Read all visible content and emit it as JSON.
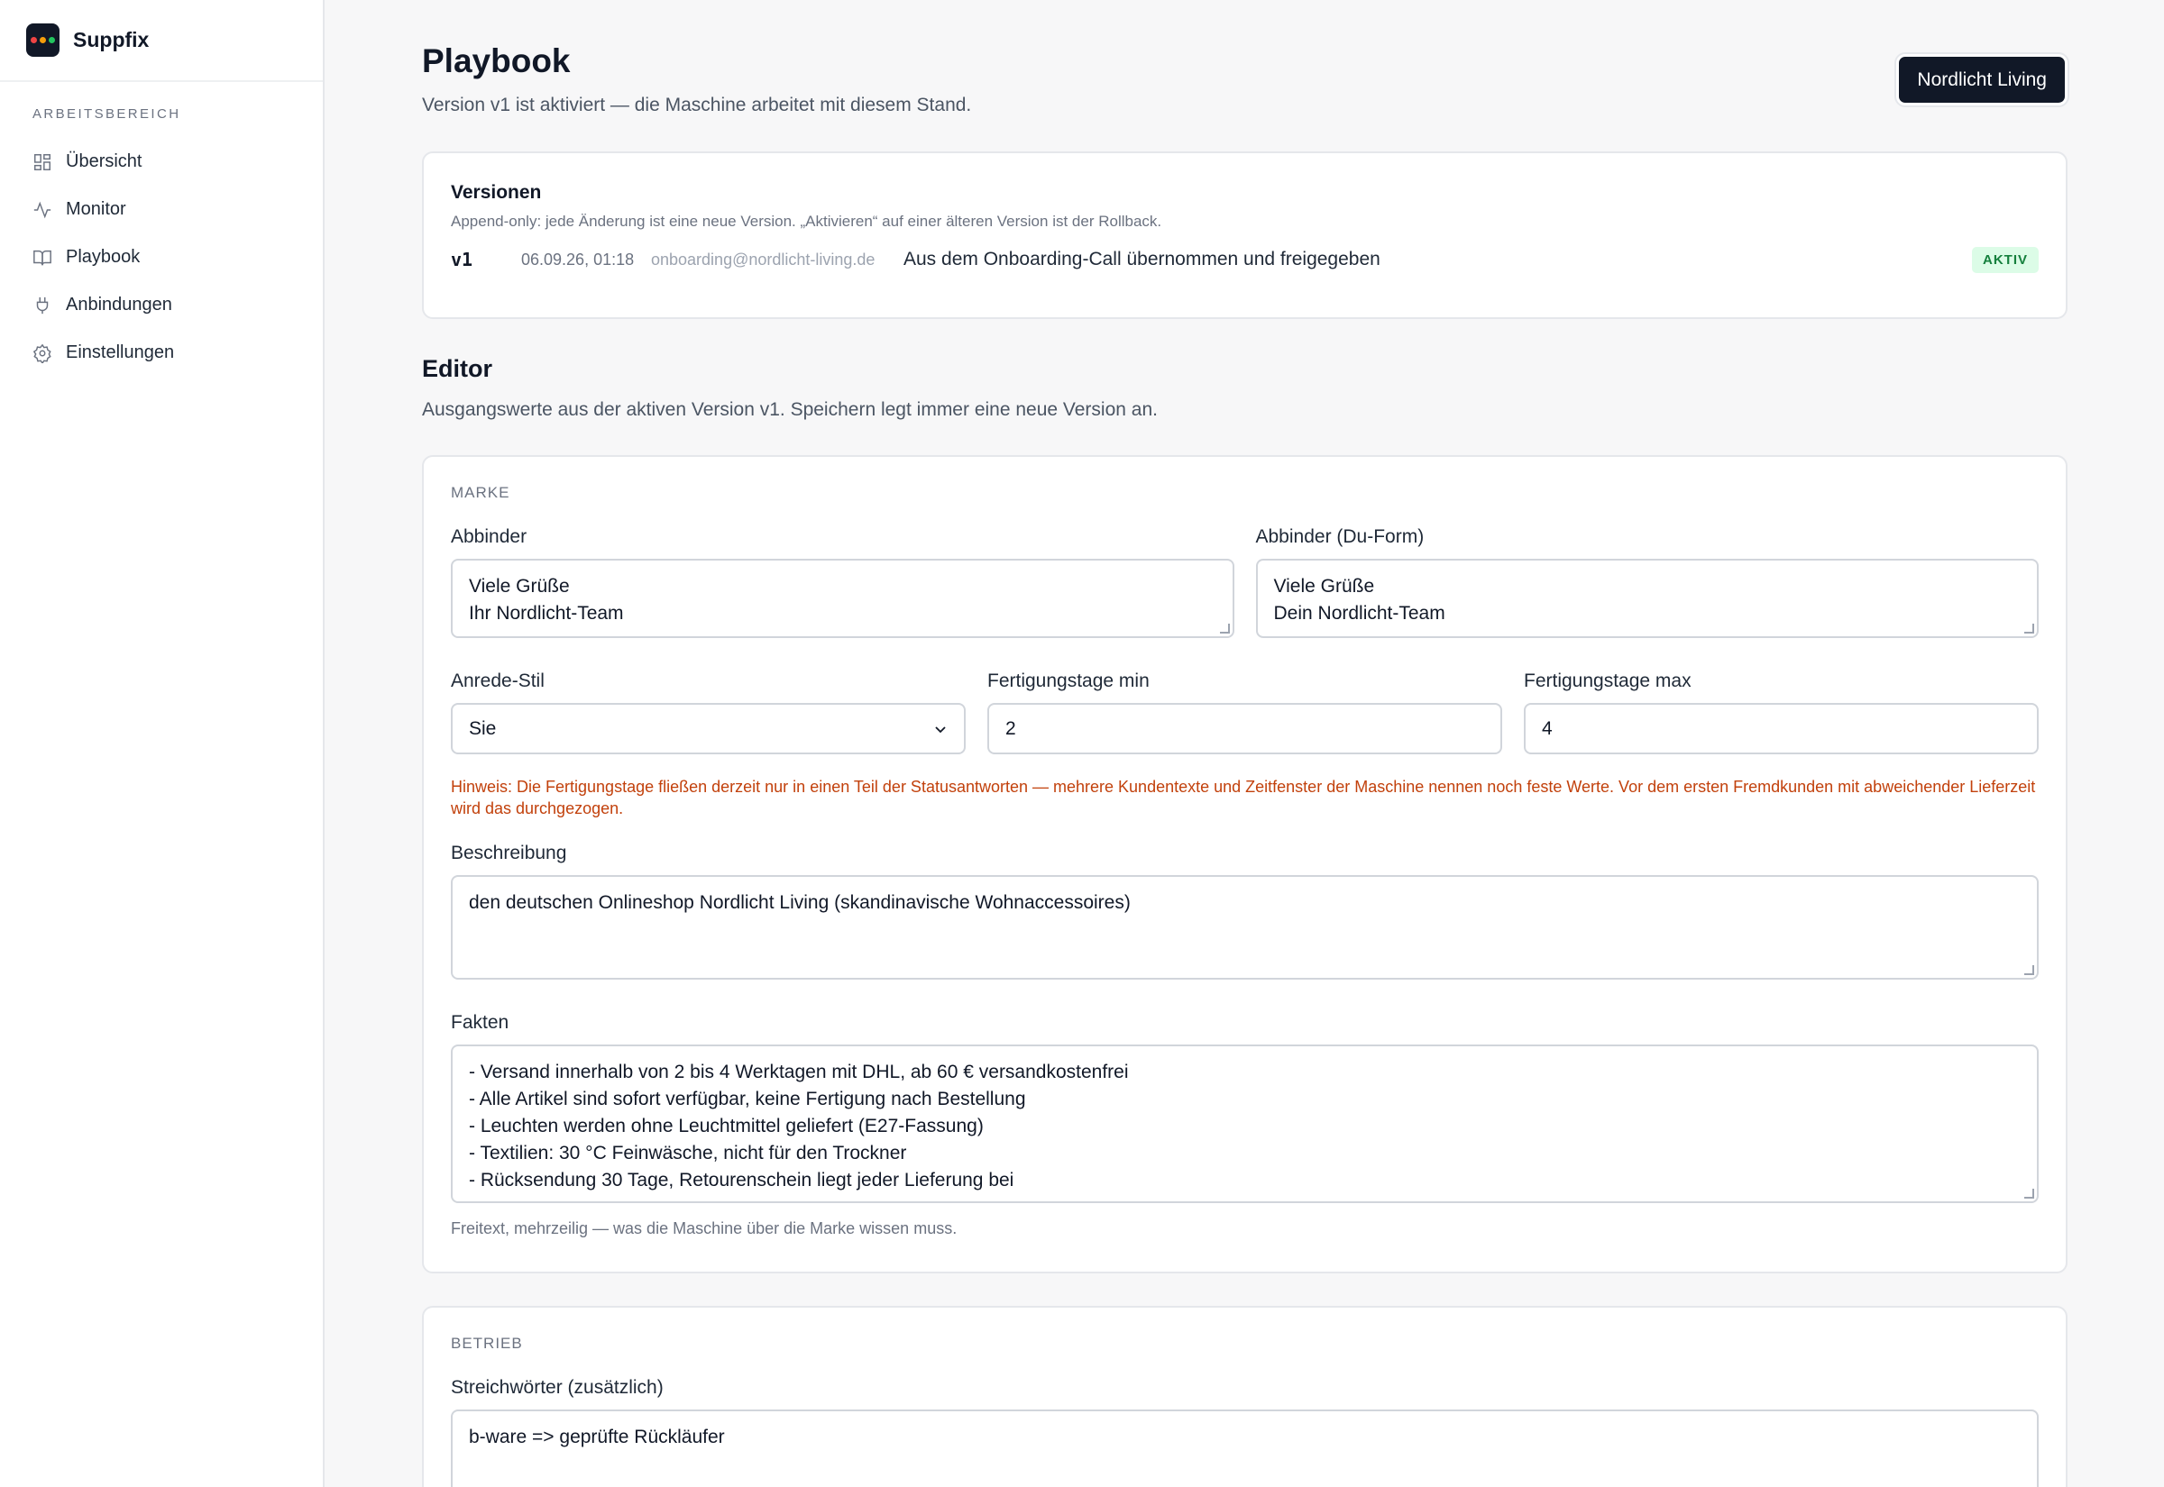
{
  "app": {
    "name": "Suppfix"
  },
  "sidebar": {
    "section_label": "ARBEITSBEREICH",
    "items": [
      {
        "label": "Übersicht",
        "icon": "grid-icon"
      },
      {
        "label": "Monitor",
        "icon": "activity-icon"
      },
      {
        "label": "Playbook",
        "icon": "book-icon"
      },
      {
        "label": "Anbindungen",
        "icon": "plug-icon"
      },
      {
        "label": "Einstellungen",
        "icon": "gear-icon"
      }
    ]
  },
  "header": {
    "title": "Playbook",
    "subtitle": "Version v1 ist aktiviert — die Maschine arbeitet mit diesem Stand.",
    "shop_button": "Nordlicht Living"
  },
  "versions": {
    "title": "Versionen",
    "description": "Append-only: jede Änderung ist eine neue Version. „Aktivieren“ auf einer älteren Version ist der Rollback.",
    "rows": [
      {
        "version": "v1",
        "date": "06.09.26, 01:18",
        "email": "onboarding@nordlicht-living.de",
        "note": "Aus dem Onboarding-Call übernommen und freigegeben",
        "badge": "AKTIV"
      }
    ]
  },
  "editor": {
    "title": "Editor",
    "description": "Ausgangswerte aus der aktiven Version v1. Speichern legt immer eine neue Version an."
  },
  "marke": {
    "section": "MARKE",
    "abbinder": {
      "label": "Abbinder",
      "value": "Viele Grüße\nIhr Nordlicht-Team"
    },
    "abbinder_du": {
      "label": "Abbinder (Du-Form)",
      "value": "Viele Grüße\nDein Nordlicht-Team"
    },
    "anrede": {
      "label": "Anrede-Stil",
      "value": "Sie"
    },
    "fert_min": {
      "label": "Fertigungstage min",
      "value": "2"
    },
    "fert_max": {
      "label": "Fertigungstage max",
      "value": "4"
    },
    "hint": "Hinweis: Die Fertigungstage fließen derzeit nur in einen Teil der Statusantworten — mehrere Kundentexte und Zeitfenster der Maschine nennen noch feste Werte. Vor dem ersten Fremdkunden mit abweichender Lieferzeit wird das durchgezogen.",
    "beschreibung": {
      "label": "Beschreibung",
      "value": "den deutschen Onlineshop Nordlicht Living (skandinavische Wohnaccessoires)"
    },
    "fakten": {
      "label": "Fakten",
      "value": "- Versand innerhalb von 2 bis 4 Werktagen mit DHL, ab 60 € versandkostenfrei\n- Alle Artikel sind sofort verfügbar, keine Fertigung nach Bestellung\n- Leuchten werden ohne Leuchtmittel geliefert (E27-Fassung)\n- Textilien: 30 °C Feinwäsche, nicht für den Trockner\n- Rücksendung 30 Tage, Retourenschein liegt jeder Lieferung bei",
      "helper": "Freitext, mehrzeilig — was die Maschine über die Marke wissen muss."
    }
  },
  "betrieb": {
    "section": "BETRIEB",
    "streichwoerter": {
      "label": "Streichwörter (zusätzlich)",
      "value": "b-ware => geprüfte Rückläufer"
    }
  },
  "colors": {
    "logo_dots": [
      "#ef4444",
      "#f59e0b",
      "#22c55e"
    ],
    "hint": "#c2410c",
    "badge_bg": "#dcfce7",
    "badge_text": "#15803d"
  }
}
